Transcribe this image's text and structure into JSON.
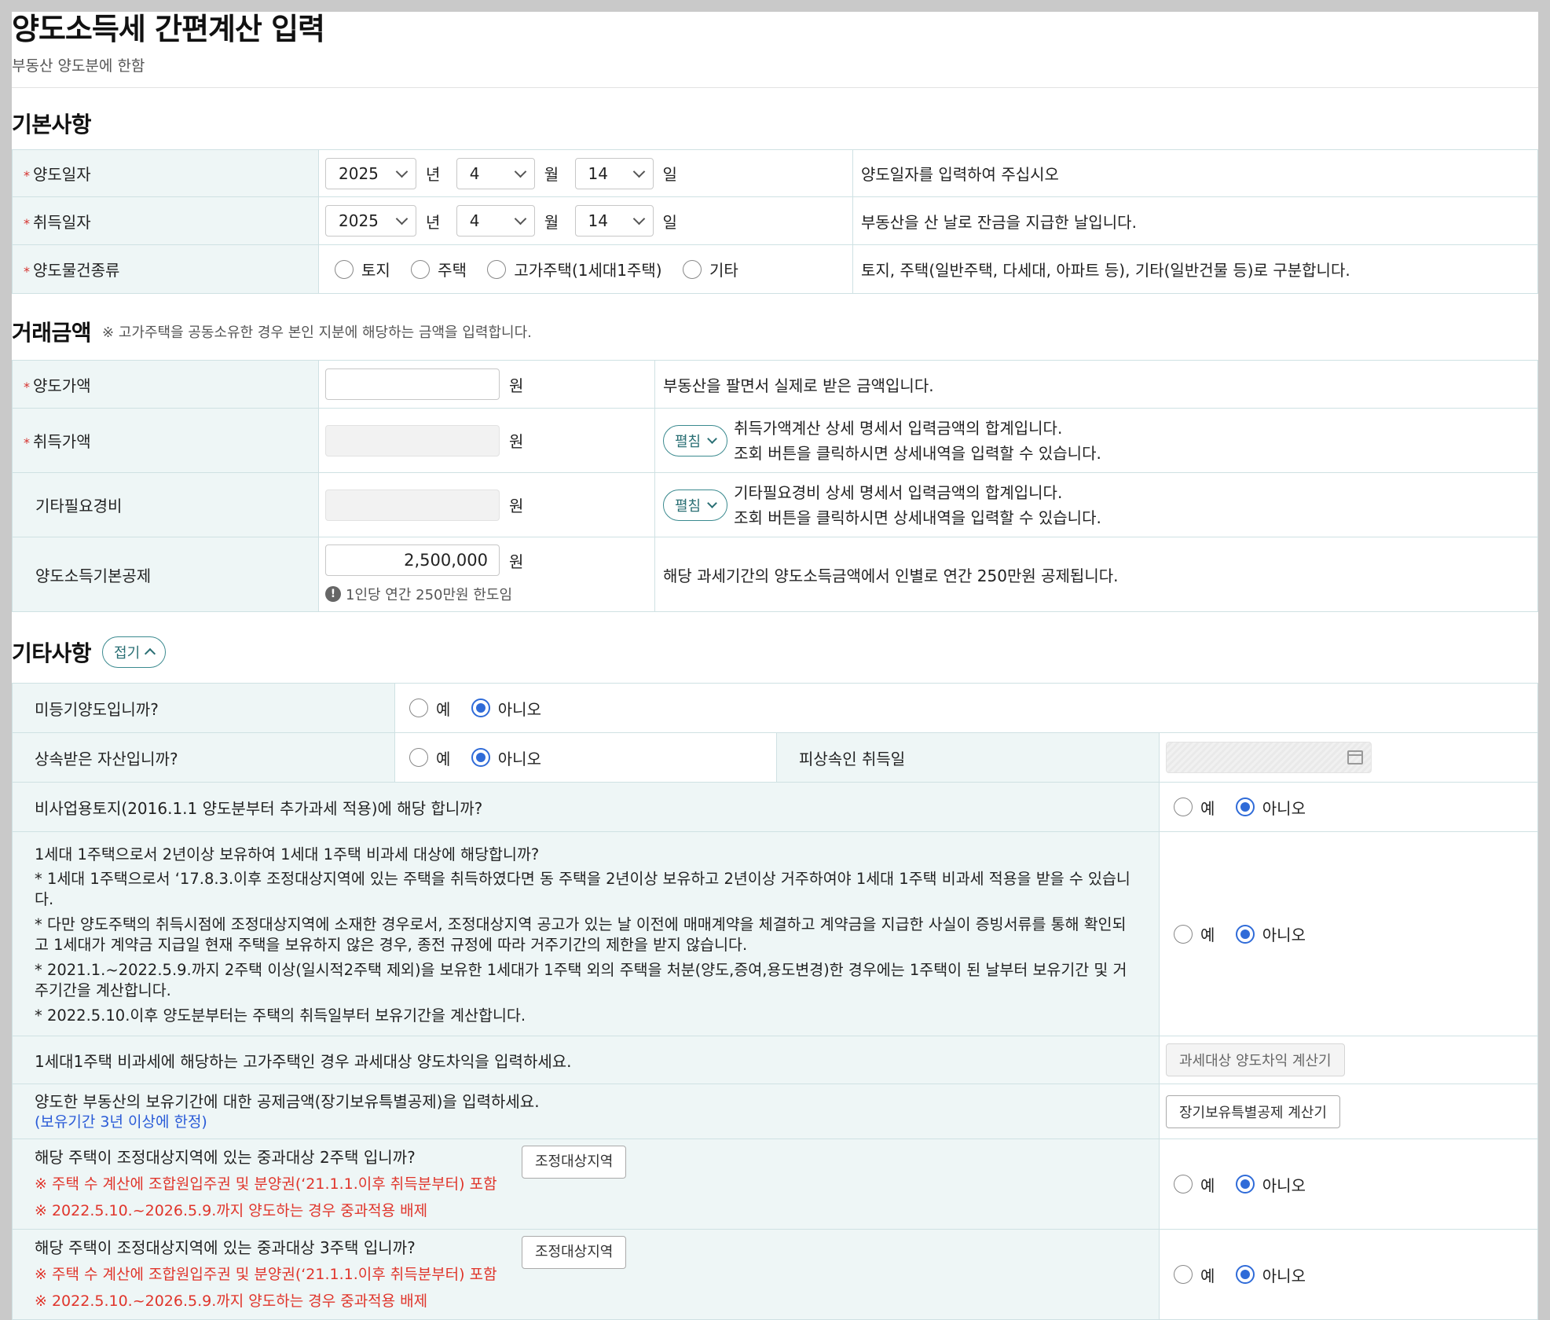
{
  "header": {
    "title": "양도소득세 간편계산 입력",
    "subtitle": "부동산 양도분에 한함"
  },
  "basic": {
    "section_title": "기본사항",
    "transfer_date": {
      "label": "양도일자",
      "year": "2025",
      "year_unit": "년",
      "month": "4",
      "month_unit": "월",
      "day": "14",
      "day_unit": "일",
      "desc": "양도일자를 입력하여 주십시오"
    },
    "acquire_date": {
      "label": "취득일자",
      "year": "2025",
      "year_unit": "년",
      "month": "4",
      "month_unit": "월",
      "day": "14",
      "day_unit": "일",
      "desc": "부동산을 산 날로 잔금을 지급한 날입니다."
    },
    "property_type": {
      "label": "양도물건종류",
      "options": [
        "토지",
        "주택",
        "고가주택(1세대1주택)",
        "기타"
      ],
      "desc": "토지, 주택(일반주택, 다세대, 아파트 등), 기타(일반건물 등)로 구분합니다."
    }
  },
  "amount": {
    "section_title": "거래금액",
    "section_note": "※ 고가주택을 공동소유한 경우 본인 지분에 해당하는 금액을 입력합니다.",
    "unit": "원",
    "transfer_price": {
      "label": "양도가액",
      "value": "",
      "desc": "부동산을 팔면서 실제로 받은 금액입니다."
    },
    "acquire_price": {
      "label": "취득가액",
      "value": "",
      "expand_label": "펼침",
      "desc1": "취득가액계산 상세 명세서 입력금액의 합계입니다.",
      "desc2": "조회 버튼을 클릭하시면 상세내역을 입력할 수 있습니다."
    },
    "other_expense": {
      "label": "기타필요경비",
      "value": "",
      "expand_label": "펼침",
      "desc1": "기타필요경비 상세 명세서 입력금액의 합계입니다.",
      "desc2": "조회 버튼을 클릭하시면 상세내역을 입력할 수 있습니다."
    },
    "basic_deduction": {
      "label": "양도소득기본공제",
      "value": "2,500,000",
      "note": "1인당 연간 250만원 한도임",
      "desc": "해당 과세기간의 양도소득금액에서 인별로 연간 250만원 공제됩니다."
    }
  },
  "other": {
    "section_title": "기타사항",
    "fold_label": "접기",
    "yes": "예",
    "no": "아니오",
    "unregistered": {
      "question": "미등기양도입니까?",
      "selected": "아니오"
    },
    "inherited": {
      "question": "상속받은 자산입니까?",
      "selected": "아니오",
      "decedent_label": "피상속인 취득일"
    },
    "non_business_land": {
      "question": "비사업용토지(2016.1.1 양도분부터 추가과세 적용)에 해당 합니까?",
      "selected": "아니오"
    },
    "one_house": {
      "question": "1세대 1주택으로서 2년이상 보유하여 1세대 1주택 비과세 대상에 해당합니까?",
      "notes": [
        "* 1세대 1주택으로서 ‘17.8.3.이후 조정대상지역에 있는 주택을 취득하였다면 동 주택을 2년이상 보유하고 2년이상 거주하여야 1세대 1주택 비과세 적용을 받을 수 있습니다.",
        "* 다만 양도주택의 취득시점에 조정대상지역에 소재한 경우로서, 조정대상지역 공고가 있는 날 이전에 매매계약을 체결하고 계약금을 지급한 사실이 증빙서류를 통해 확인되고 1세대가 계약금 지급일 현재 주택을 보유하지 않은 경우, 종전 규정에 따라 거주기간의 제한을 받지 않습니다.",
        "* 2021.1.~2022.5.9.까지 2주택 이상(일시적2주택 제외)을 보유한 1세대가 1주택 외의 주택을 처분(양도,증여,용도변경)한 경우에는 1주택이 된 날부터 보유기간 및 거주기간을 계산합니다.",
        "* 2022.5.10.이후 양도분부터는 주택의 취득일부터 보유기간을 계산합니다."
      ],
      "selected": "아니오"
    },
    "high_price": {
      "question": "1세대1주택 비과세에 해당하는 고가주택인 경우 과세대상 양도차익을 입력하세요.",
      "button": "과세대상 양도차익 계산기"
    },
    "long_term": {
      "question": "양도한 부동산의 보유기간에 대한 공제금액(장기보유특별공제)을 입력하세요.",
      "note": "(보유기간 3년 이상에 한정)",
      "button": "장기보유특별공제 계산기"
    },
    "two_house": {
      "question": "해당 주택이 조정대상지역에 있는 중과대상 2주택 입니까?",
      "button": "조정대상지역",
      "note1": "※ 주택 수 계산에 조합원입주권 및 분양권(‘21.1.1.이후 취득분부터) 포함",
      "note2": "※ 2022.5.10.~2026.5.9.까지 양도하는 경우 중과적용 배제",
      "selected": "아니오"
    },
    "three_house": {
      "question": "해당 주택이 조정대상지역에 있는 중과대상 3주택 입니까?",
      "button": "조정대상지역",
      "note1": "※ 주택 수 계산에 조합원입주권 및 분양권(‘21.1.1.이후 취득분부터) 포함",
      "note2": "※ 2022.5.10.~2026.5.9.까지 양도하는 경우 중과적용 배제",
      "selected": "아니오"
    }
  },
  "colors": {
    "label_bg": "#eef6f6",
    "accent_teal": "#3b8a8f",
    "radio_blue": "#2f6bd8",
    "required_red": "#d5322e",
    "note_blue": "#2a5bd7"
  }
}
